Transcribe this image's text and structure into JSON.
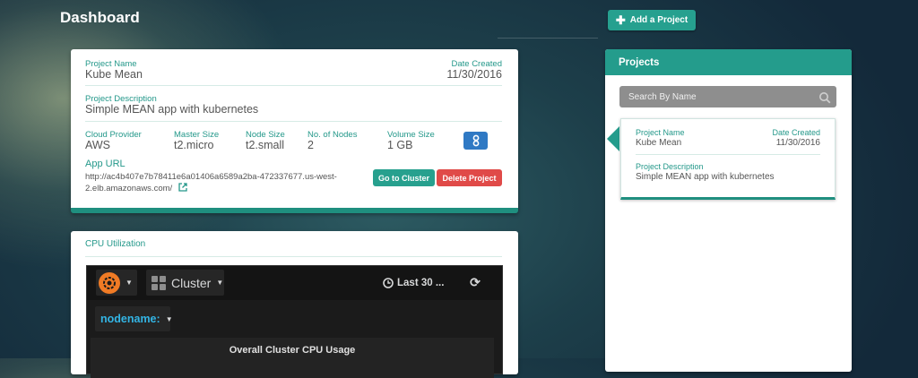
{
  "page": {
    "title": "Dashboard"
  },
  "toolbar": {
    "add_project_label": "Add a Project"
  },
  "project": {
    "name_label": "Project Name",
    "name": "Kube Mean",
    "date_label": "Date Created",
    "date": "11/30/2016",
    "description_label": "Project Description",
    "description": "Simple MEAN app with kubernetes",
    "cloud_provider_label": "Cloud Provider",
    "cloud_provider": "AWS",
    "master_size_label": "Master Size",
    "master_size": "t2.micro",
    "node_size_label": "Node Size",
    "node_size": "t2.small",
    "nodes_label": "No. of Nodes",
    "nodes": "2",
    "volume_label": "Volume Size",
    "volume": "1 GB",
    "app_url_label": "App URL",
    "app_url": "http://ac4b407e7b78411e6a01406a6589a2ba-472337677.us-west-2.elb.amazonaws.com/",
    "go_to_cluster_label": "Go to Cluster",
    "delete_label": "Delete Project"
  },
  "cpu": {
    "title": "CPU Utilization",
    "dashboard_name": "Cluster",
    "time_range": "Last 30 ...",
    "variable_label": "nodename:",
    "panel_title": "Overall Cluster CPU Usage"
  },
  "sidebar": {
    "title": "Projects",
    "search_placeholder": "Search By Name",
    "items": [
      {
        "name_label": "Project Name",
        "name": "Kube Mean",
        "date_label": "Date Created",
        "date": "11/30/2016",
        "description_label": "Project Description",
        "description": "Simple MEAN app with kubernetes"
      }
    ]
  },
  "colors": {
    "accent": "#249c8c",
    "danger": "#e04a48",
    "info": "#2f79c4",
    "grafana_orange": "#f07b25",
    "grafana_blue": "#33b5e5"
  },
  "icons": [
    "plus-icon",
    "kubernetes-icon",
    "external-link-icon",
    "grafana-logo-icon",
    "grid-icon",
    "clock-icon",
    "refresh-icon",
    "search-icon",
    "caret-down-icon"
  ]
}
